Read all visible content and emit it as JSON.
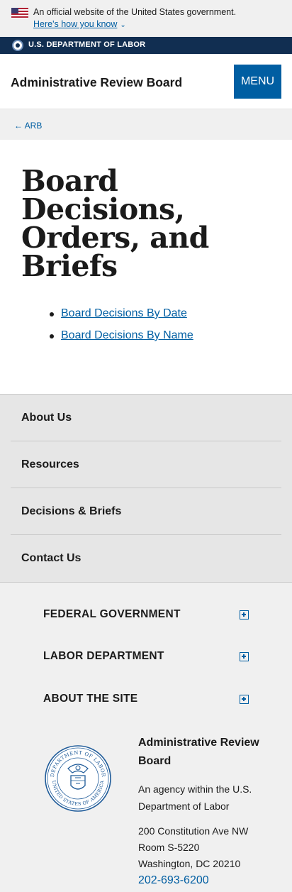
{
  "gov_banner": {
    "official_text": "An official website of the United States government.",
    "how_you_know_link": "Here's how you know",
    "flag_icon": "us-flag-icon",
    "chevron_icon": "chevron-down-icon"
  },
  "agency_bar": {
    "label": "U.S. DEPARTMENT OF LABOR",
    "seal_icon": "dol-seal-icon"
  },
  "header": {
    "site_title": "Administrative Review Board",
    "menu_button": "MENU"
  },
  "breadcrumb": {
    "back_link": "← ARB"
  },
  "main": {
    "title": "Board Decisions, Orders, and Briefs",
    "links": [
      {
        "label": "Board Decisions By Date"
      },
      {
        "label": "Board Decisions By Name"
      }
    ]
  },
  "side_nav": {
    "items": [
      {
        "label": "About Us"
      },
      {
        "label": "Resources"
      },
      {
        "label": "Decisions & Briefs"
      },
      {
        "label": "Contact Us"
      }
    ]
  },
  "footer": {
    "accordions": [
      {
        "label": "FEDERAL GOVERNMENT"
      },
      {
        "label": "LABOR DEPARTMENT"
      },
      {
        "label": "ABOUT THE SITE"
      }
    ],
    "agency_name": "Administrative Review Board",
    "agency_desc": "An agency within the U.S. Department of Labor",
    "address_line1": "200 Constitution Ave NW",
    "address_line2": "Room S-5220",
    "address_line3": "Washington, DC 20210",
    "phone": "202-693-6200",
    "seal_text_top": "DEPARTMENT OF LABOR",
    "seal_text_bottom": "UNITED STATES OF AMERICA"
  },
  "colors": {
    "link": "#005ea2",
    "agency_bar": "#112e51",
    "banner_bg": "#f0f0f0",
    "nav_bg": "#e6e6e6"
  }
}
